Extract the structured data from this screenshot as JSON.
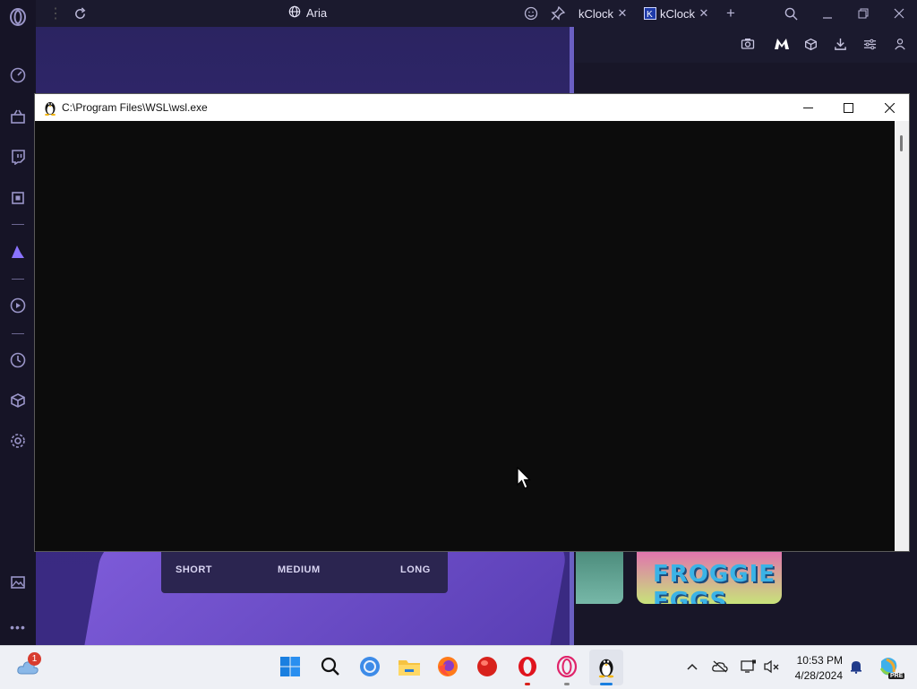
{
  "browser": {
    "tab_title": "Aria",
    "tabs": [
      {
        "label": "kClock"
      },
      {
        "label": "kClock"
      }
    ],
    "sidebar_icons": [
      "opera-logo-icon",
      "speed-dial-icon",
      "shopping-icon",
      "twitch-icon",
      "chip-icon",
      "aria-icon",
      "player-icon",
      "history-icon",
      "extensions-icon",
      "settings-icon",
      "gallery-icon",
      "more-icon"
    ],
    "toolbar_icons": [
      "camera-icon",
      "malwarebytes-icon",
      "cube-icon",
      "download-icon",
      "easy-setup-icon",
      "profile-icon"
    ]
  },
  "page": {
    "length_options": [
      "SHORT",
      "MEDIUM",
      "LONG"
    ],
    "game_thumbnail_text": "FROGGIE EGGS"
  },
  "wsl_window": {
    "title": "C:\\Program Files\\WSL\\wsl.exe",
    "minimize_label": "—",
    "maximize_label": "☐",
    "close_label": "✕"
  },
  "taskbar": {
    "weather_badge": "1",
    "apps": [
      "start-icon",
      "search-icon",
      "chrome-icon",
      "file-explorer-icon",
      "firefox-icon",
      "red-app-icon",
      "opera-icon",
      "opera-gx-icon",
      "wsl-penguin-icon"
    ],
    "time": "10:53 PM",
    "date": "4/28/2024",
    "copilot_badge": "PRE"
  },
  "colors": {
    "accent": "#7b61ff",
    "taskbar_bg": "#eef0f5",
    "console_bg": "#0c0c0c"
  }
}
